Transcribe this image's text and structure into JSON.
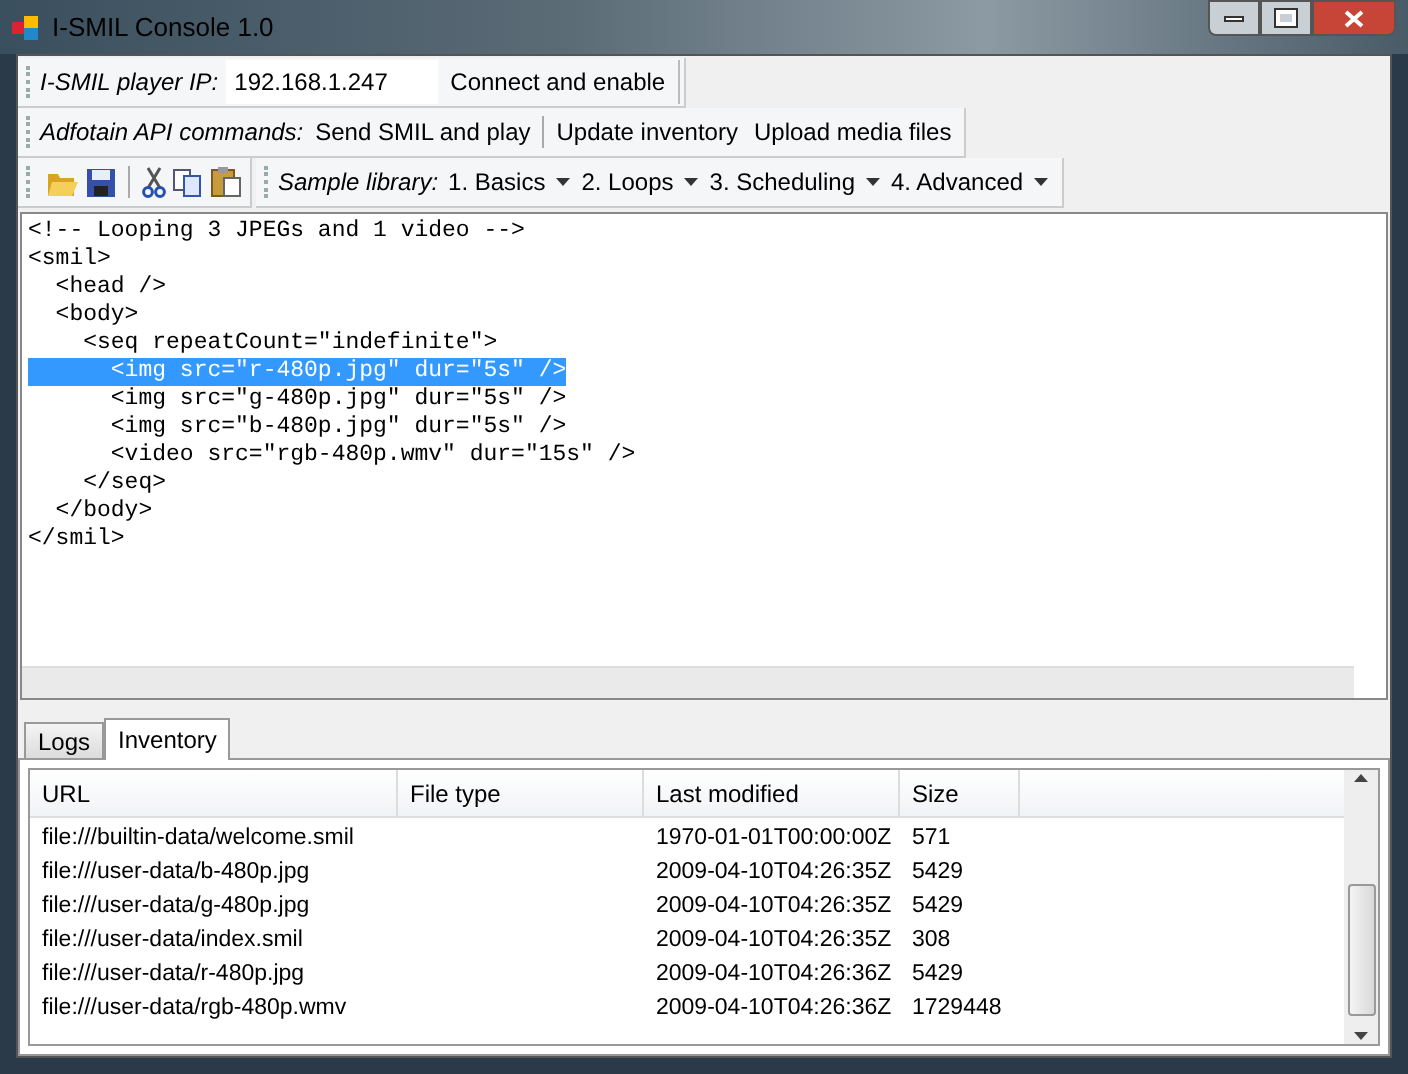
{
  "window": {
    "title": "I-SMIL Console 1.0"
  },
  "player_bar": {
    "label": "I-SMIL player IP:",
    "ip_field": "192.168.1.247",
    "connect_button": "Connect and enable"
  },
  "api_bar": {
    "label": "Adfotain API commands:",
    "buttons": [
      "Send SMIL and play",
      "Update inventory",
      "Upload media files"
    ]
  },
  "sample_bar": {
    "label": "Sample library:",
    "menus": [
      "1. Basics",
      "2. Loops",
      "3. Scheduling",
      "4. Advanced"
    ]
  },
  "editor": {
    "lines": [
      {
        "text": "<!-- Looping 3 JPEGs and 1 video -->",
        "selected": false
      },
      {
        "text": "<smil>",
        "selected": false
      },
      {
        "text": "  <head />",
        "selected": false
      },
      {
        "text": "  <body>",
        "selected": false
      },
      {
        "text": "    <seq repeatCount=\"indefinite\">",
        "selected": false
      },
      {
        "text": "      <img src=\"r-480p.jpg\" dur=\"5s\" />",
        "selected": true
      },
      {
        "text": "      <img src=\"g-480p.jpg\" dur=\"5s\" />",
        "selected": false
      },
      {
        "text": "      <img src=\"b-480p.jpg\" dur=\"5s\" />",
        "selected": false
      },
      {
        "text": "      <video src=\"rgb-480p.wmv\" dur=\"15s\" />",
        "selected": false
      },
      {
        "text": "    </seq>",
        "selected": false
      },
      {
        "text": "  </body>",
        "selected": false
      },
      {
        "text": "</smil>",
        "selected": false
      }
    ]
  },
  "tabs": [
    {
      "label": "Logs",
      "selected": false
    },
    {
      "label": "Inventory",
      "selected": true
    }
  ],
  "table": {
    "columns": [
      "URL",
      "File type",
      "Last modified",
      "Size"
    ],
    "rows": [
      {
        "url": "file:///builtin-data/welcome.smil",
        "last_modified": "1970-01-01T00:00:00Z",
        "size": "571"
      },
      {
        "url": "file:///user-data/b-480p.jpg",
        "last_modified": "2009-04-10T04:26:35Z",
        "size": "5429"
      },
      {
        "url": "file:///user-data/g-480p.jpg",
        "last_modified": "2009-04-10T04:26:35Z",
        "size": "5429"
      },
      {
        "url": "file:///user-data/index.smil",
        "last_modified": "2009-04-10T04:26:35Z",
        "size": "308"
      },
      {
        "url": "file:///user-data/r-480p.jpg",
        "last_modified": "2009-04-10T04:26:36Z",
        "size": "5429"
      },
      {
        "url": "file:///user-data/rgb-480p.wmv",
        "last_modified": "2009-04-10T04:26:36Z",
        "size": "1729448"
      }
    ]
  }
}
